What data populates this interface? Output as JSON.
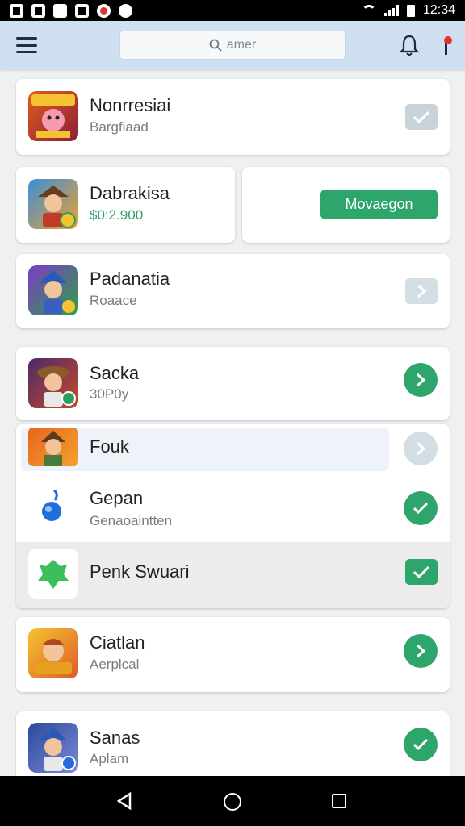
{
  "status_bar": {
    "time": "12:34"
  },
  "app_bar": {
    "search_placeholder": "amer"
  },
  "items": [
    {
      "title": "Nonrresiai",
      "subtitle": "Bargfiaad",
      "action": "check-square-grey"
    },
    {
      "title": "Dabrakisa",
      "subtitle": "$0:2.900",
      "action_label": "Movaegon"
    },
    {
      "title": "Padanatia",
      "subtitle": "Roaace",
      "action": "chevron-square-grey"
    },
    {
      "title": "Sacka",
      "subtitle": "30P0y",
      "action": "chevron-circle-green"
    },
    {
      "title": "Fouk",
      "action": "chevron-circle-grey"
    },
    {
      "title": "Gepan",
      "subtitle": "Genaoaintten",
      "action": "check-circle-green"
    },
    {
      "title": "Penk Swuari",
      "action": "check-square-green"
    },
    {
      "title": "Ciatlan",
      "subtitle": "Aerplcal",
      "action": "chevron-circle-green"
    },
    {
      "title": "Sanas",
      "subtitle": "Aplam",
      "action": "check-circle-green"
    }
  ],
  "colors": {
    "accent_green": "#2ea66b",
    "appbar_bg": "#cfe0f2",
    "check_grey": "#c9d3da"
  }
}
